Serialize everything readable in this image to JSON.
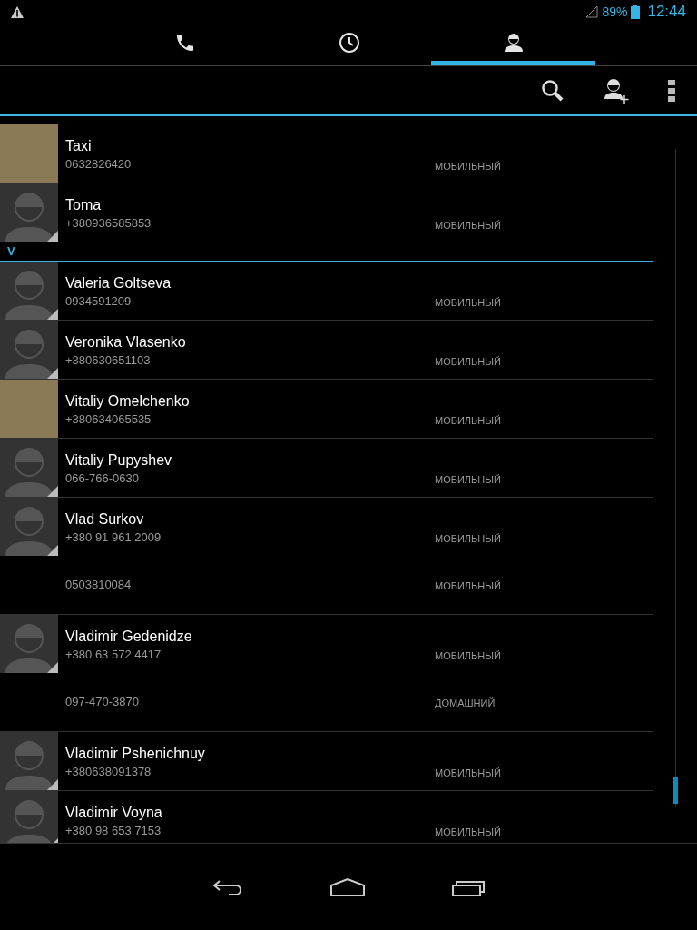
{
  "status_bar": {
    "battery": "89%",
    "time": "12:44"
  },
  "tabs": [
    {
      "kind": "phone",
      "selected": false
    },
    {
      "kind": "recent",
      "selected": false
    },
    {
      "kind": "contacts",
      "selected": true
    }
  ],
  "list": [
    {
      "kind": "contact",
      "name": "Taxi",
      "avatar": {
        "kind": "photo"
      },
      "phones": [
        {
          "number": "0632826420",
          "type": "МОБИЛЬНЫЙ"
        }
      ]
    },
    {
      "kind": "contact",
      "name": "Toma",
      "avatar": {
        "kind": "default"
      },
      "phones": [
        {
          "number": "+380936585853",
          "type": "МОБИЛЬНЫЙ"
        }
      ]
    },
    {
      "kind": "header",
      "letter": "V"
    },
    {
      "kind": "contact",
      "name": "Valeria Goltseva",
      "avatar": {
        "kind": "default"
      },
      "phones": [
        {
          "number": "0934591209",
          "type": "МОБИЛЬНЫЙ"
        }
      ]
    },
    {
      "kind": "contact",
      "name": "Veronika Vlasenko",
      "avatar": {
        "kind": "default"
      },
      "phones": [
        {
          "number": "+380630651103",
          "type": "МОБИЛЬНЫЙ"
        }
      ]
    },
    {
      "kind": "contact",
      "name": "Vitaliy Omelchenko",
      "avatar": {
        "kind": "photo"
      },
      "phones": [
        {
          "number": "+380634065535",
          "type": "МОБИЛЬНЫЙ"
        }
      ]
    },
    {
      "kind": "contact",
      "name": "Vitaliy Pupyshev",
      "avatar": {
        "kind": "default"
      },
      "phones": [
        {
          "number": "066-766-0630",
          "type": "МОБИЛЬНЫЙ"
        }
      ]
    },
    {
      "kind": "contact",
      "name": "Vlad Surkov",
      "avatar": {
        "kind": "default"
      },
      "phones": [
        {
          "number": "+380 91 961 2009",
          "type": "МОБИЛЬНЫЙ"
        },
        {
          "number": "0503810084",
          "type": "МОБИЛЬНЫЙ"
        }
      ]
    },
    {
      "kind": "contact",
      "name": "Vladimir Gedenidze",
      "avatar": {
        "kind": "default"
      },
      "phones": [
        {
          "number": "+380 63 572 4417",
          "type": "МОБИЛЬНЫЙ"
        },
        {
          "number": "097-470-3870",
          "type": "ДОМАШНИЙ"
        }
      ]
    },
    {
      "kind": "contact",
      "name": "Vladimir Pshenichnuy",
      "avatar": {
        "kind": "default"
      },
      "phones": [
        {
          "number": "+380638091378",
          "type": "МОБИЛЬНЫЙ"
        }
      ]
    },
    {
      "kind": "contact",
      "name": "Vladimir Voyna",
      "avatar": {
        "kind": "default"
      },
      "phones": [
        {
          "number": "+380 98 653 7153",
          "type": "МОБИЛЬНЫЙ"
        }
      ]
    }
  ]
}
